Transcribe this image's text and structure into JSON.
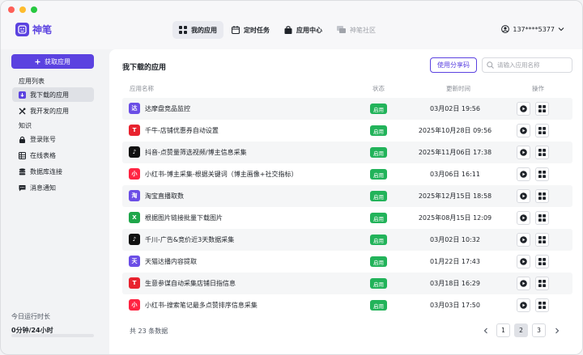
{
  "app": {
    "name": "神笔"
  },
  "colors": {
    "accent": "#5b42e0",
    "status_green": "#22b35a",
    "dot_red": "#fe5f57",
    "dot_yellow": "#febc2e",
    "dot_green": "#28c840"
  },
  "topnav": [
    {
      "label": "我的应用",
      "icon": "grid-icon",
      "active": true
    },
    {
      "label": "定时任务",
      "icon": "calendar-icon",
      "active": false
    },
    {
      "label": "应用中心",
      "icon": "bag-icon",
      "active": false
    },
    {
      "label": "神笔社区",
      "icon": "chat-icon",
      "active": false,
      "disabled": true
    }
  ],
  "user": {
    "phone": "137****5377"
  },
  "sidebar": {
    "get_app": "获取应用",
    "section_apps": "应用列表",
    "apps_items": [
      {
        "label": "我下载的应用",
        "icon": "download-app-icon",
        "active": true
      },
      {
        "label": "我开发的应用",
        "icon": "tools-icon",
        "active": false
      }
    ],
    "section_knowledge": "知识",
    "knowledge_items": [
      {
        "label": "登录账号",
        "icon": "lock-icon"
      },
      {
        "label": "在线表格",
        "icon": "table-icon"
      },
      {
        "label": "数据库连接",
        "icon": "database-icon"
      },
      {
        "label": "消息通知",
        "icon": "message-icon"
      }
    ],
    "runtime_label": "今日运行时长",
    "runtime_value": "0分钟/24小时",
    "runtime_progress": 0
  },
  "main": {
    "title": "我下载的应用",
    "share_button": "使用分享码",
    "search_placeholder": "请输入应用名称",
    "columns": {
      "name": "应用名称",
      "status": "状态",
      "updated": "更新时间",
      "actions": "操作"
    },
    "rows": [
      {
        "icon_text": "达",
        "icon_color": "#6b4ee6",
        "name": "达摩盘竞品监控",
        "status": "启用",
        "updated": "03月02日 19:56"
      },
      {
        "icon_text": "T",
        "icon_color": "#e8232f",
        "name": "千牛-店铺优惠券自动设置",
        "status": "启用",
        "updated": "2025年10月28日 09:56"
      },
      {
        "icon_text": "♪",
        "icon_color": "#111111",
        "name": "抖音-点赞量筛选视频/博主信息采集",
        "status": "启用",
        "updated": "2025年11月06日 17:38"
      },
      {
        "icon_text": "小",
        "icon_color": "#ff2442",
        "name": "小红书-博主采集-根据关键词（博主画像+社交指标）",
        "status": "启用",
        "updated": "03月06日 16:11"
      },
      {
        "icon_text": "淘",
        "icon_color": "#6b4ee6",
        "name": "淘宝直播取数",
        "status": "启用",
        "updated": "2025年12月15日 18:58"
      },
      {
        "icon_text": "X",
        "icon_color": "#1fa64a",
        "name": "根据图片链接批量下载图片",
        "status": "启用",
        "updated": "2025年08月15日 12:09"
      },
      {
        "icon_text": "♪",
        "icon_color": "#111111",
        "name": "千川-广告&竞价近3天数据采集",
        "status": "启用",
        "updated": "03月02日 10:32"
      },
      {
        "icon_text": "天",
        "icon_color": "#6b4ee6",
        "name": "天猫达播内容提取",
        "status": "启用",
        "updated": "01月22日 17:43"
      },
      {
        "icon_text": "T",
        "icon_color": "#e8232f",
        "name": "生意参谋自动采集店铺日指信息",
        "status": "启用",
        "updated": "03月18日 16:29"
      },
      {
        "icon_text": "小",
        "icon_color": "#ff2442",
        "name": "小红书-搜索笔记最多点赞排序信息采集",
        "status": "启用",
        "updated": "03月03日 17:50"
      }
    ],
    "total": "共 23 条数据",
    "pages": [
      "1",
      "2",
      "3"
    ],
    "current_page": "2"
  }
}
